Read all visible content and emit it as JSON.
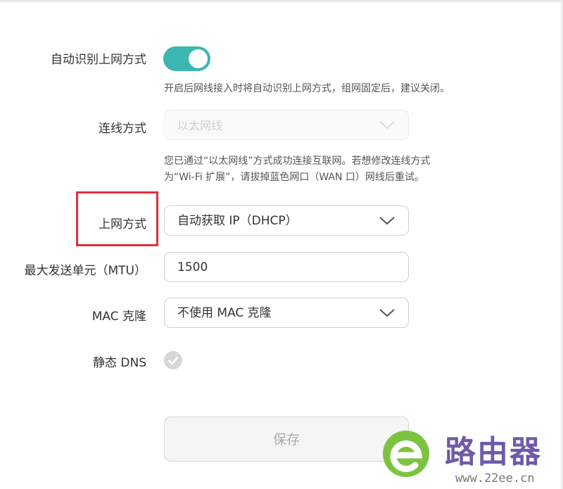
{
  "auto_detect": {
    "label": "自动识别上网方式",
    "enabled": true,
    "help": "开启后网线接入时将自动识别上网方式，组网固定后，建议关闭。"
  },
  "connection_mode": {
    "label": "连线方式",
    "value": "以太网线",
    "disabled": true,
    "help_line1": "您已通过“以太网线”方式成功连接互联网。若想修改连线方式",
    "help_line2": "为“Wi-Fi 扩展”，请拔掉蓝色网口（WAN 口）网线后重试。"
  },
  "internet_mode": {
    "label": "上网方式",
    "value": "自动获取 IP（DHCP）"
  },
  "mtu": {
    "label": "最大发送单元（MTU）",
    "value": "1500"
  },
  "mac_clone": {
    "label": "MAC 克隆",
    "value": "不使用 MAC 克隆"
  },
  "static_dns": {
    "label": "静态 DNS",
    "checked": false
  },
  "save_button": {
    "label": "保存"
  },
  "watermark": {
    "text": "路由器",
    "url": "www.22ee.cn"
  },
  "colors": {
    "toggle_on": "#3bb6b0",
    "highlight": "#e0303a",
    "watermark_green": "#7cc440",
    "watermark_purple": "#6e5aa8"
  }
}
